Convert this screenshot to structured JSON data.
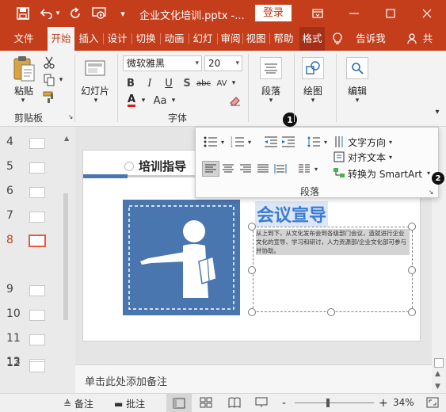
{
  "titlebar": {
    "doc_title": "企业文化培训.pptx  -...",
    "login": "登录",
    "icons": [
      "save-icon",
      "undo-icon",
      "redo-icon",
      "present-icon",
      "customize-icon",
      "ribbon-display-icon",
      "minimize-icon",
      "maximize-icon",
      "close-icon"
    ]
  },
  "tabs": {
    "file": "文件",
    "home": "开始",
    "insert": "插入",
    "design": "设计",
    "transitions": "切换",
    "animations": "动画",
    "slideshow": "幻灯",
    "review": "审阅",
    "view": "视图",
    "help": "帮助",
    "format": "格式",
    "tellme": "告诉我",
    "share": "共"
  },
  "ribbon": {
    "paste": "粘贴",
    "clipboard": "剪贴板",
    "slides": "幻灯片",
    "font_name": "微软雅黑",
    "font_size": "20",
    "bold": "B",
    "italic": "I",
    "underline": "U",
    "shadow": "S",
    "strike": "abc",
    "spacing": "AV",
    "font_color": "A",
    "change_case": "Aa",
    "font_group": "字体",
    "paragraph": "段落",
    "drawing": "绘图",
    "editing": "编辑"
  },
  "popup": {
    "text_direction": "文字方向",
    "align_text": "对齐文本",
    "convert_smartart": "转换为 SmartArt",
    "group_label": "段落",
    "callout1": "1",
    "callout2": "2"
  },
  "thumbnails": {
    "numbers": [
      "4",
      "5",
      "6",
      "7",
      "8",
      "9",
      "10",
      "11",
      "12",
      "13"
    ],
    "selected": "8"
  },
  "slide": {
    "heading": "培训指导",
    "title": "会议宣导",
    "body": "从上到下，从文化发布会到各级部门会议，造就进行企业文化的宣导、学习和研讨，人力资源部/企业文化部可参与并协助。"
  },
  "notes": {
    "placeholder": "单击此处添加备注"
  },
  "statusbar": {
    "notes": "备注",
    "comments": "批注",
    "zoom": "34%",
    "zoom_in": "+",
    "zoom_out": "-"
  },
  "colors": {
    "accent": "#c43e1c",
    "slide_blue": "#4a76b0",
    "title_blue": "#3a7bd5"
  }
}
